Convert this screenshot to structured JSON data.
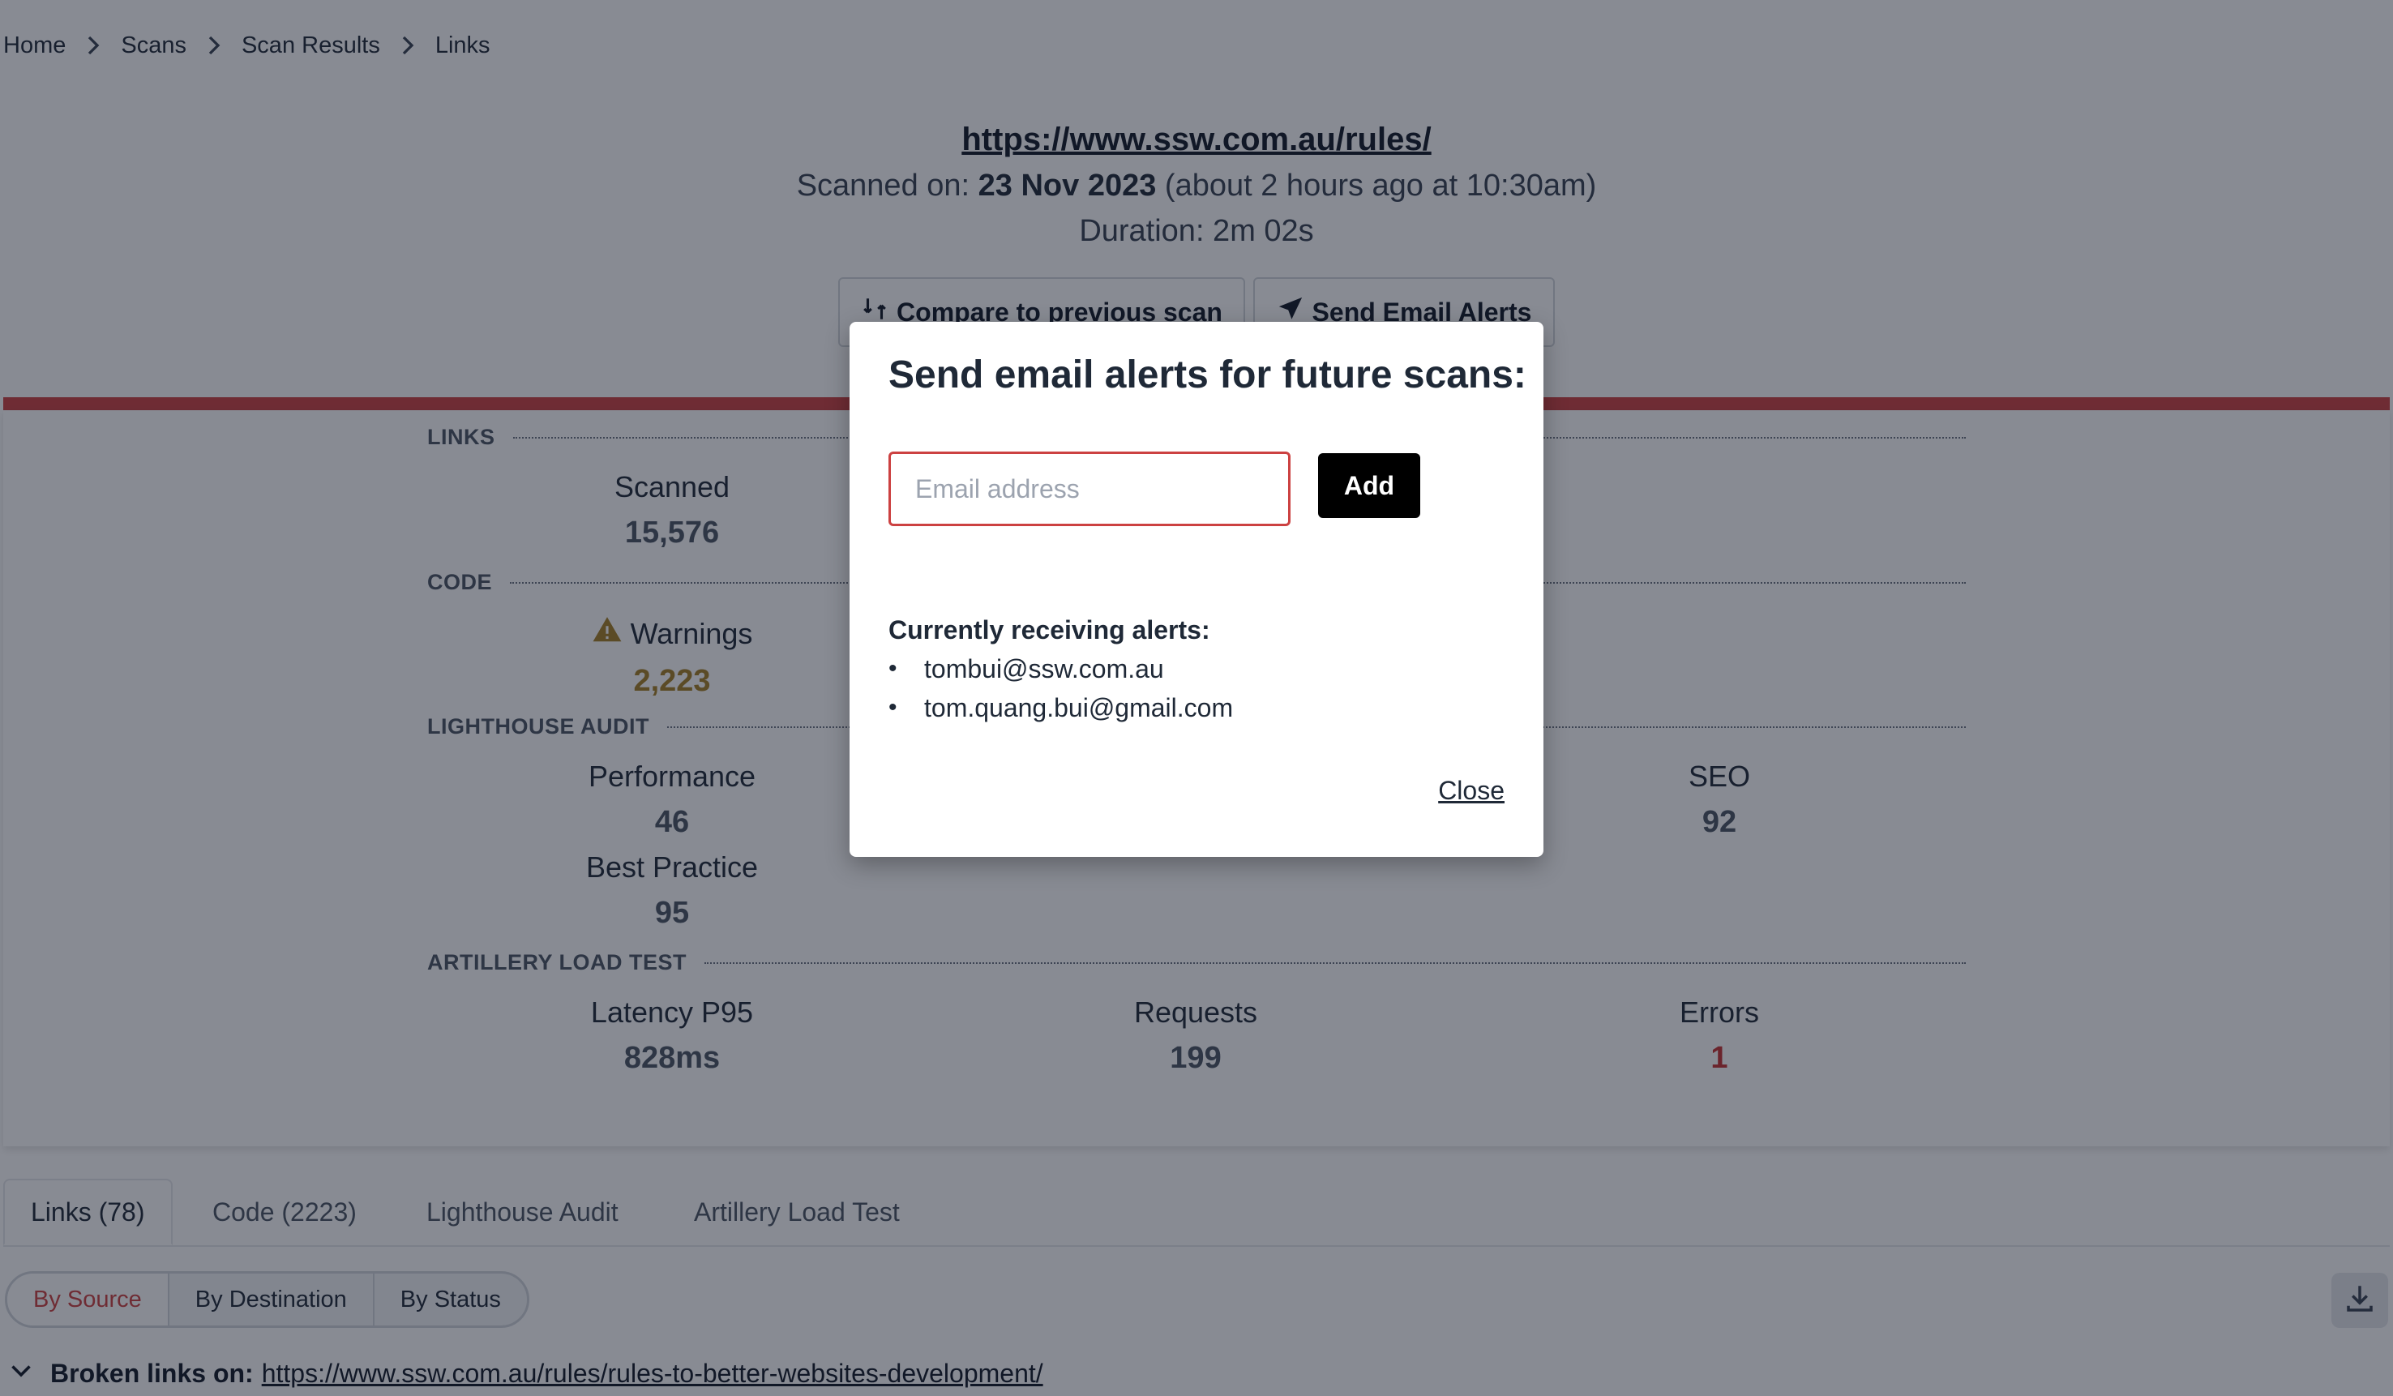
{
  "breadcrumb": [
    "Home",
    "Scans",
    "Scan Results",
    "Links"
  ],
  "header": {
    "url": "https://www.ssw.com.au/rules/",
    "scanned_prefix": "Scanned on: ",
    "scanned_date": "23 Nov 2023",
    "scanned_suffix": " (about 2 hours ago at 10:30am)",
    "duration": "Duration: 2m 02s",
    "compare_button": "Compare to previous scan",
    "email_button": "Send Email Alerts"
  },
  "summary": {
    "links_title": "LINKS",
    "links": [
      {
        "label": "Scanned",
        "value": "15,576"
      }
    ],
    "code_title": "CODE",
    "code": [
      {
        "label": "Warnings",
        "value": "2,223"
      }
    ],
    "lighthouse_title": "LIGHTHOUSE AUDIT",
    "lighthouse": [
      {
        "label": "Performance",
        "value": "46"
      },
      {
        "label": "SEO",
        "value": "92"
      },
      {
        "label": "Best Practice",
        "value": "95"
      }
    ],
    "artillery_title": "ARTILLERY LOAD TEST",
    "artillery": [
      {
        "label": "Latency P95",
        "value": "828ms"
      },
      {
        "label": "Requests",
        "value": "199"
      },
      {
        "label": "Errors",
        "value": "1"
      }
    ]
  },
  "tabs": [
    "Links (78)",
    "Code (2223)",
    "Lighthouse Audit",
    "Artillery Load Test"
  ],
  "segments": [
    "By Source",
    "By Destination",
    "By Status"
  ],
  "broken": {
    "label": "Broken links on:",
    "url": "https://www.ssw.com.au/rules/rules-to-better-websites-development/"
  },
  "modal": {
    "title": "Send email alerts for future scans:",
    "email_placeholder": "Email address",
    "add_button": "Add",
    "receiving_title": "Currently receiving alerts:",
    "emails": [
      "tombui@ssw.com.au",
      "tom.quang.bui@gmail.com"
    ],
    "close": "Close"
  },
  "colors": {
    "accent": "#cc4141",
    "warning": "#a57f24"
  }
}
